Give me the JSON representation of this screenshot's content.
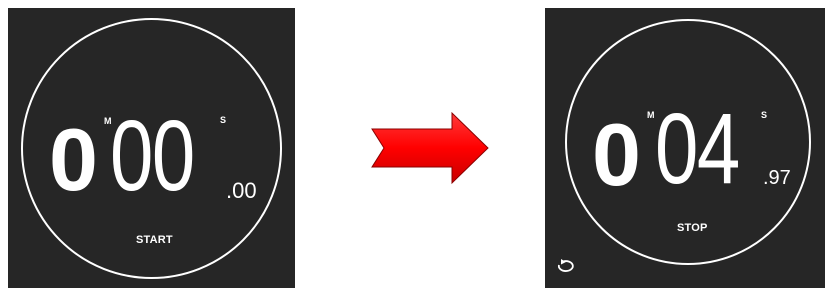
{
  "before": {
    "minutes": "0",
    "minutes_unit": "M",
    "seconds": "00",
    "seconds_unit": "S",
    "hundredths": ".00",
    "action_label": "START"
  },
  "after": {
    "minutes": "0",
    "minutes_unit": "M",
    "seconds": "04",
    "seconds_unit": "S",
    "hundredths": ".97",
    "action_label": "STOP"
  },
  "icons": {
    "transition": "right-arrow-icon",
    "reset": "reset-icon"
  },
  "colors": {
    "panel_background": "#262626",
    "dial_and_text": "#ffffff",
    "arrow_fill": "#ff0000",
    "page_background": "#ffffff"
  }
}
